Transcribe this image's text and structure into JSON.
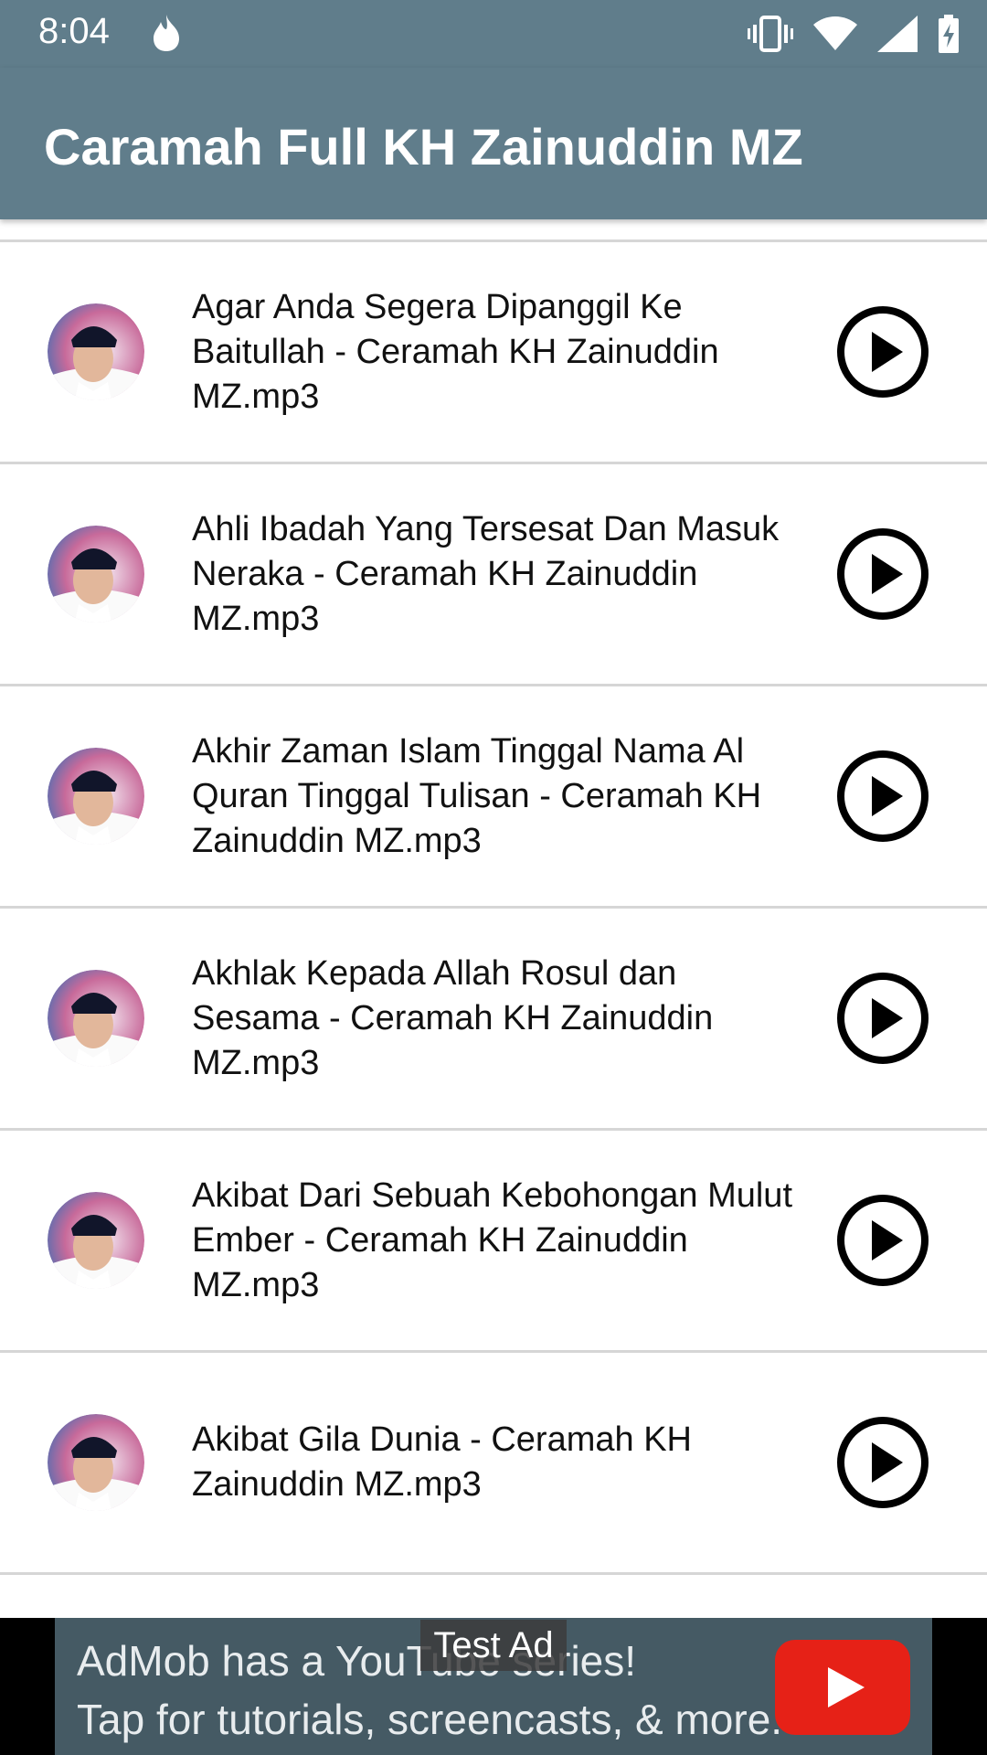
{
  "status_bar": {
    "time": "8:04"
  },
  "app_bar": {
    "title": "Caramah Full KH Zainuddin MZ"
  },
  "list": {
    "items": [
      {
        "title": "Agar Anda Segera Dipanggil Ke Baitullah - Ceramah KH Zainuddin MZ.mp3"
      },
      {
        "title": "Ahli Ibadah Yang Tersesat Dan Masuk Neraka - Ceramah KH Zainuddin MZ.mp3"
      },
      {
        "title": "Akhir Zaman Islam Tinggal Nama Al Quran Tinggal Tulisan - Ceramah KH Zainuddin MZ.mp3"
      },
      {
        "title": "Akhlak Kepada Allah Rosul dan Sesama - Ceramah KH Zainuddin MZ.mp3"
      },
      {
        "title": "Akibat Dari Sebuah Kebohongan Mulut Ember - Ceramah KH Zainuddin MZ.mp3"
      },
      {
        "title": "Akibat Gila Dunia - Ceramah KH Zainuddin MZ.mp3"
      }
    ]
  },
  "ad": {
    "badge": "Test Ad",
    "line1": "AdMob has a YouTube series!",
    "line2": "Tap for tutorials, screencasts, & more."
  },
  "colors": {
    "primary": "#607d8b",
    "ad_background": "#455a64",
    "youtube_red": "#e62117"
  },
  "icons": {
    "status": [
      "flame-icon",
      "vibrate-icon",
      "wifi-icon",
      "signal-icon",
      "battery-charging-icon"
    ],
    "row_action": "play-circle-icon",
    "row_thumbnail": "avatar-image",
    "ad_logo": "youtube-play-icon"
  }
}
